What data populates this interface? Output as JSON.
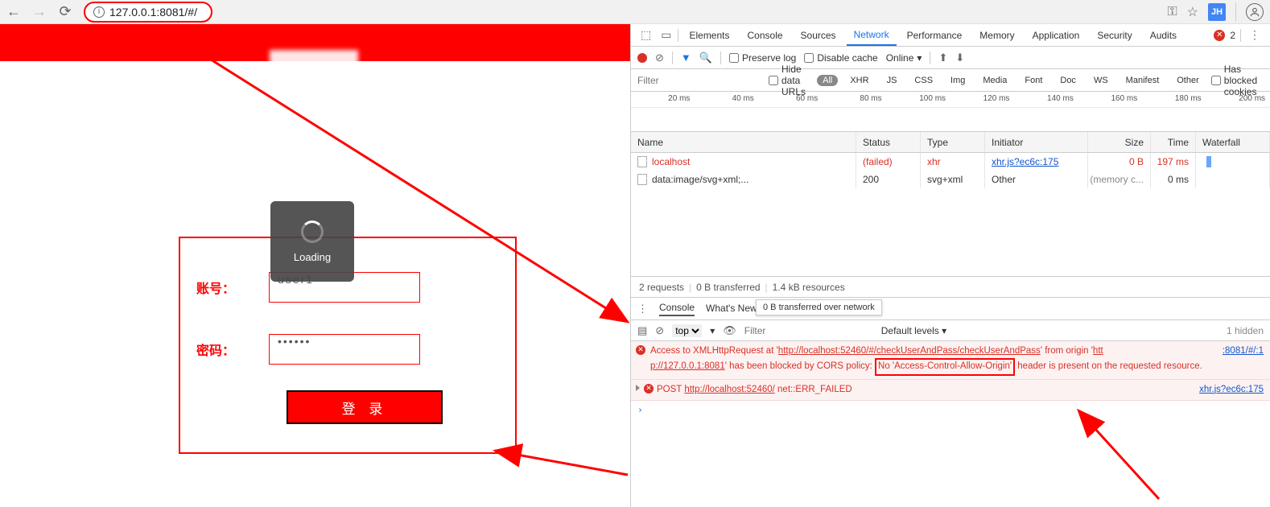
{
  "browser": {
    "url": "127.0.0.1:8081/#/",
    "ext_badge": "JH"
  },
  "page": {
    "account_label": "账号：",
    "password_label": "密码：",
    "account_value": "user1",
    "password_value": "••••••",
    "login_button": "登 录",
    "loading_text": "Loading"
  },
  "devtools": {
    "tabs": [
      "Elements",
      "Console",
      "Sources",
      "Network",
      "Performance",
      "Memory",
      "Application",
      "Security",
      "Audits"
    ],
    "active_tab": "Network",
    "error_count": "2",
    "toolbar": {
      "preserve_log": "Preserve log",
      "disable_cache": "Disable cache",
      "online": "Online"
    },
    "filter": {
      "placeholder": "Filter",
      "hide_data_urls": "Hide data URLs",
      "types": [
        "All",
        "XHR",
        "JS",
        "CSS",
        "Img",
        "Media",
        "Font",
        "Doc",
        "WS",
        "Manifest",
        "Other"
      ],
      "has_blocked": "Has blocked cookies"
    },
    "timeline": [
      "20 ms",
      "40 ms",
      "60 ms",
      "80 ms",
      "100 ms",
      "120 ms",
      "140 ms",
      "160 ms",
      "180 ms",
      "200 ms"
    ],
    "net_headers": {
      "name": "Name",
      "status": "Status",
      "type": "Type",
      "initiator": "Initiator",
      "size": "Size",
      "time": "Time",
      "waterfall": "Waterfall"
    },
    "net_rows": [
      {
        "name": "localhost",
        "status": "(failed)",
        "type": "xhr",
        "initiator": "xhr.js?ec6c:175",
        "size": "0 B",
        "time": "197 ms",
        "failed": true
      },
      {
        "name": "data:image/svg+xml;...",
        "status": "200",
        "type": "svg+xml",
        "initiator": "Other",
        "size": "(memory c...",
        "time": "0 ms",
        "failed": false
      }
    ],
    "summary": {
      "requests": "2 requests",
      "transferred": "0 B transferred",
      "resources": "1.4 kB resources"
    },
    "tooltip": "0 B transferred over network",
    "console_tabs": [
      "Console",
      "What's New"
    ],
    "console_bar": {
      "context": "top",
      "filter_ph": "Filter",
      "levels": "Default levels ▾",
      "hidden": "1 hidden"
    },
    "console_msgs": {
      "m1_a": "Access to XMLHttpRequest at '",
      "m1_url1": "http://localhost:52460/#/checkUserAndPass/checkUserAndPass",
      "m1_b": "' from origin '",
      "m1_url2": "htt",
      "m1_src": ":8081/#/:1",
      "m1_c": "p://127.0.0.1:8081",
      "m1_d": "' has been blocked by CORS policy: ",
      "m1_box": "No 'Access-Control-Allow-Origin'",
      "m1_e": " header is present on the requested resource.",
      "m2_a": "POST ",
      "m2_url": "http://localhost:52460/",
      "m2_b": " net::ERR_FAILED",
      "m2_src": "xhr.js?ec6c:175"
    }
  }
}
